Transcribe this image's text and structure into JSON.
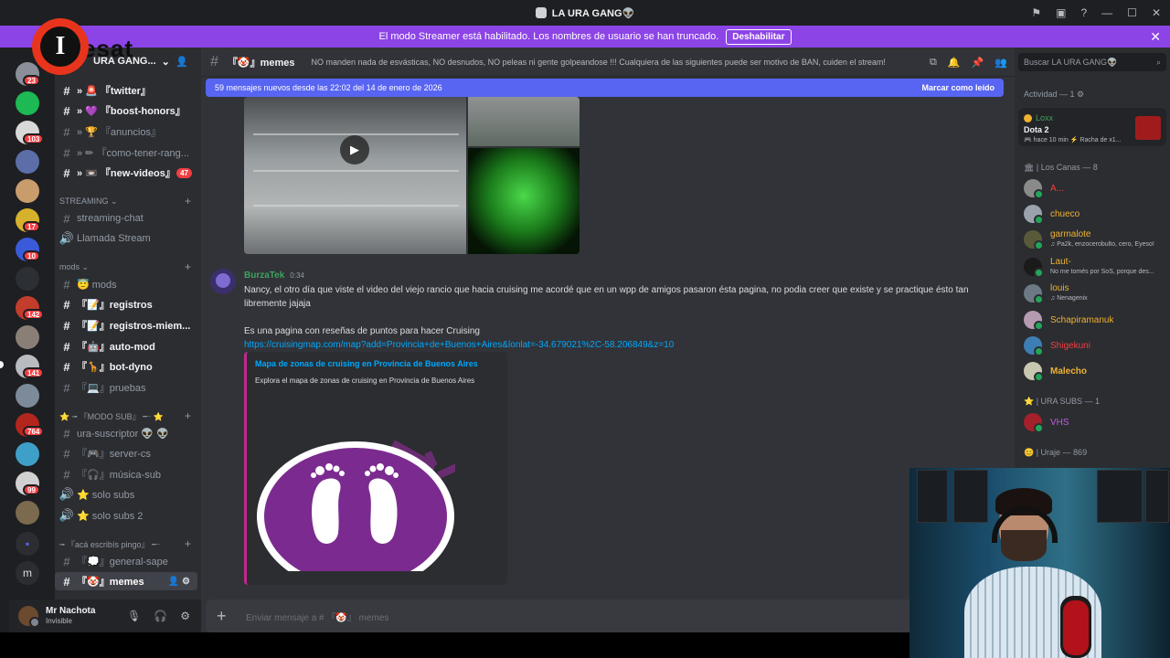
{
  "window": {
    "title": "LA URA GANG👽"
  },
  "banner": {
    "text": "El modo Streamer está habilitado. Los nombres de usuario se han truncado.",
    "button": "Deshabilitar"
  },
  "overlay": {
    "logo_letter": "I",
    "logo_text": "esat"
  },
  "rail": {
    "badges": [
      "23",
      "103",
      "17",
      "10",
      "142",
      "141",
      "764",
      "99"
    ]
  },
  "guild": {
    "name": "URA GANG..."
  },
  "channels": [
    {
      "label": "» 🚨 『twitter』"
    },
    {
      "label": "» 💜 『boost-honors』"
    },
    {
      "label": "» 🏆 『anuncios』"
    },
    {
      "label": "» ✏ 『como-tener-rang..."
    },
    {
      "label": "» 📼 『new-videos』",
      "badge": "47"
    },
    {
      "label": "streaming-chat"
    },
    {
      "label": "Llamada Stream"
    },
    {
      "label": "😇 mods"
    },
    {
      "label": "『📝』registros"
    },
    {
      "label": "『📝』registros-miem..."
    },
    {
      "label": "『🤖』auto-mod"
    },
    {
      "label": "『🦒』bot-dyno"
    },
    {
      "label": "『💻』pruebas"
    },
    {
      "label": "ura-suscriptor 👽 👽"
    },
    {
      "label": "『🎮』server-cs"
    },
    {
      "label": "『🎧』música-sub"
    },
    {
      "label": "⭐ solo subs"
    },
    {
      "label": "⭐ solo subs 2"
    },
    {
      "label": "『💭』general-sape"
    },
    {
      "label": "『🤡』memes"
    }
  ],
  "categories": {
    "streaming": "STREAMING ⌄",
    "mods": "mods ⌄",
    "modo_sub": "⭐ ╼ 『MODO SUB』 ╾ ⭐",
    "aca": "╼ 『acá escribís pingo』 ╾"
  },
  "user": {
    "name": "Mr Nachota",
    "status": "Invisible"
  },
  "chat": {
    "channel": "『🤡』memes",
    "topic": "NO manden nada de esvásticas, NO desnudos, NO peleas ni gente golpeandose !!! Cualquiera de las siguientes puede ser motivo de BAN, cuiden el stream!",
    "new_messages": "59 mensajes nuevos desde las 22:02 del 14 de enero de 2026",
    "mark_read": "Marcar como leído",
    "placeholder": "Enviar mensaje a # 『🤡』 memes"
  },
  "message": {
    "author": "BurzaTek",
    "time": "0:34",
    "line1": "Nancy, el otro día que viste el video del viejo rancio que hacia cruising me acordé que en un wpp de amigos pasaron ésta pagina, no podia creer que existe y se practique ésto tan",
    "line2": "libremente jajaja",
    "line3": "Es una pagina con reseñas de puntos para hacer Cruising",
    "link": "https://cruisingmap.com/map?add=Provincia+de+Buenos+Aires&lonlat=-34.679021%2C-58.206849&z=10",
    "embed_title": "Mapa de zonas de cruising en Provincia de Buenos Aires",
    "embed_desc": "Explora el mapa de zonas de cruising en Provincia de Buenos Aires"
  },
  "members": {
    "search_placeholder": "Buscar LA URA GANG👽",
    "activity_header": "Actividad — 1 ⚙",
    "activity": {
      "name": "Loxx",
      "game": "Dota 2",
      "time": "🎮 hace 10 min  ⚡ Racha de x1..."
    },
    "groups": [
      {
        "title": "🏛 | Los Canas — 8"
      },
      {
        "title": "⭐ | URA SUBS — 1"
      },
      {
        "title": "😊 | Uraje — 869"
      }
    ],
    "list": [
      {
        "name": "A...",
        "sub": "",
        "color": "#f23f43"
      },
      {
        "name": "chueco",
        "sub": "",
        "color": "#f0b232"
      },
      {
        "name": "garmalote",
        "sub": "♫ Pa2k, enzocerobulto, cero, Eyeso!",
        "color": "#f0b232"
      },
      {
        "name": "Laut-",
        "sub": "No me tomés por SoS, porque des...",
        "color": "#f0b232"
      },
      {
        "name": "louis",
        "sub": "♫ Nenagenix",
        "color": "#f0b232"
      },
      {
        "name": "Schapiramanuk",
        "sub": "",
        "color": "#f0b232"
      },
      {
        "name": "Shigekuni",
        "sub": "",
        "color": "#f23f43"
      },
      {
        "name": "Malecho",
        "sub": "",
        "color": "#f0b232"
      },
      {
        "name": "VHS",
        "sub": "",
        "color": "#c15cdb"
      }
    ]
  }
}
